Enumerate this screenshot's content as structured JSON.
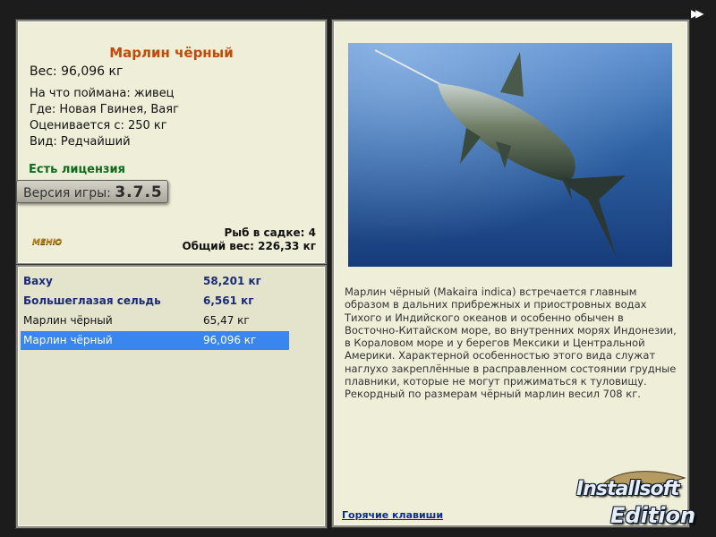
{
  "fish": {
    "name": "Марлин чёрный",
    "weight": "Вес: 96,096 кг",
    "bait": "На что поймана: живец",
    "location": "Где: Новая Гвинея, Ваяг",
    "valued": "Оценивается с: 250 кг",
    "rarity": "Вид: Редчайший"
  },
  "license": "Есть лицензия",
  "version": {
    "label": "Версия игры:",
    "value": "3.7.5"
  },
  "small_logo": "МЕНЮ",
  "stats": {
    "fish_in_keepnet": "Рыб в садке: 4",
    "total_weight": "Общий вес: 226,33 кг"
  },
  "catch_list": [
    {
      "name": "Ваху",
      "weight": "58,201 кг",
      "style": "bold"
    },
    {
      "name": "Большеглазая сельдь",
      "weight": "6,561 кг",
      "style": "bold"
    },
    {
      "name": "Марлин чёрный",
      "weight": "65,47 кг",
      "style": "normal"
    },
    {
      "name": "Марлин чёрный",
      "weight": "96,096 кг",
      "style": "selected"
    }
  ],
  "description": "Марлин чёрный (Makaira indica) встречается главным образом в дальних прибрежных и приостровных водах Тихого и Индийского океанов и особенно обычен в Восточно-Китайском море, во внутренних морях Индонезии, в Кораловом море и у берегов Мексики и Центральной Америки. Характерной особенностью этого вида служат наглухо закреплённые в расправленном состоянии грудные плавники, которые не могут прижиматься к туловищу. Рекордный по размерам чёрный марлин весил 708 кг.",
  "hotkeys": "Горячие клавиши",
  "watermark": {
    "line1": "Installsoft",
    "line2": "Edition"
  },
  "nav_icon": "fast-forward-icon",
  "colors": {
    "title": "#c24a08",
    "license": "#0b6b1e",
    "list_bold": "#1b2a7a",
    "selection": "#3a86f0",
    "link": "#0c2b96"
  }
}
